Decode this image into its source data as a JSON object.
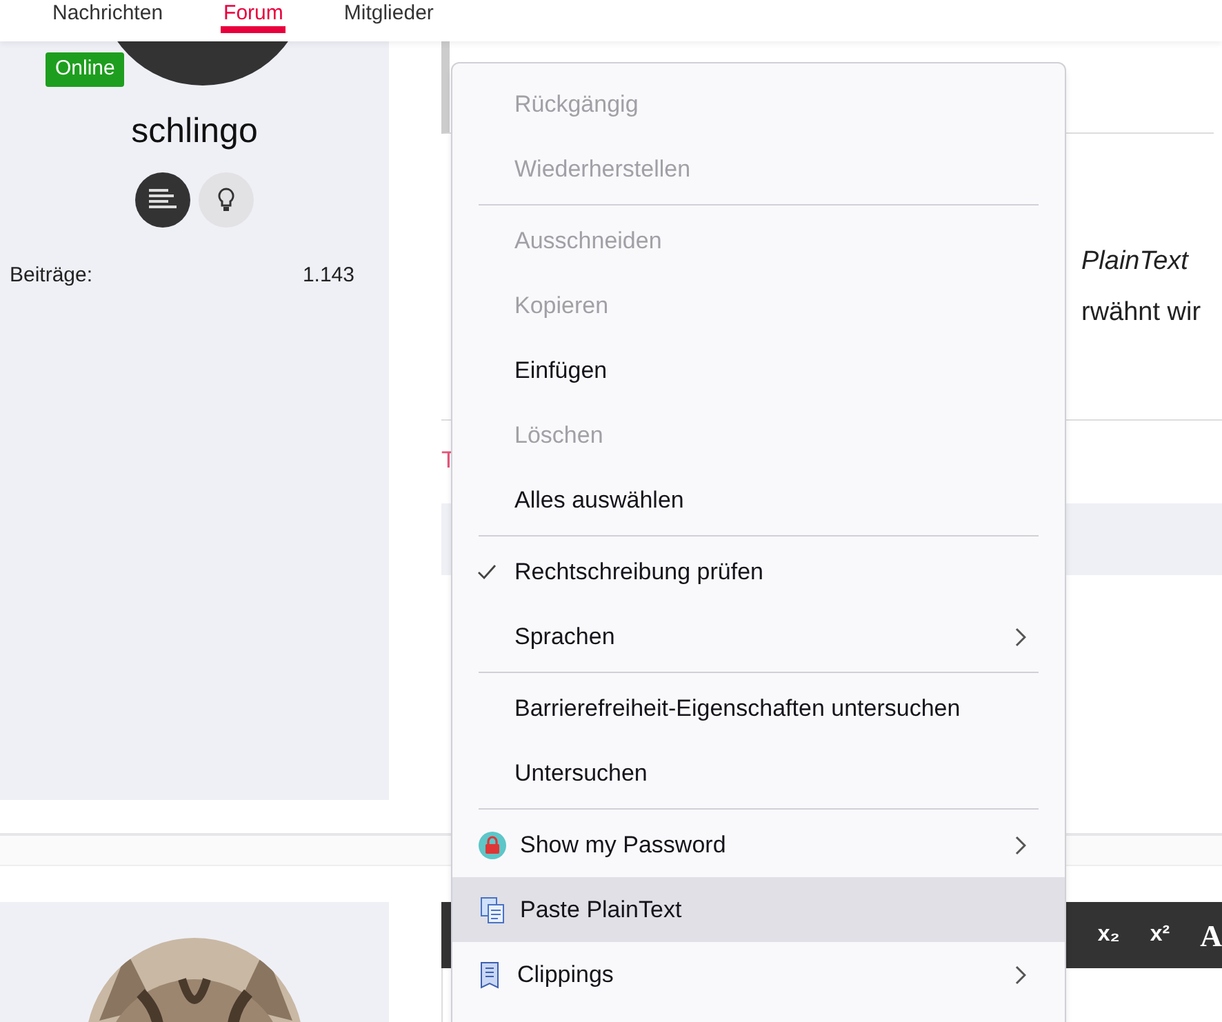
{
  "nav": [
    {
      "label": "Nachrichten",
      "selected": false
    },
    {
      "label": "Forum",
      "selected": true
    },
    {
      "label": "Mitglieder",
      "selected": false
    }
  ],
  "author": {
    "status": "Online",
    "name": "schlingo",
    "stats": [
      {
        "label": "Beiträge:",
        "value": "1.143"
      }
    ]
  },
  "post": {
    "lines": [
      {
        "right": "PlainText",
        "italic": true
      },
      {
        "right": "rwähnt wir",
        "italic": false
      }
    ],
    "links": [
      "T"
    ]
  },
  "context_menu": [
    {
      "kind": "item",
      "label": "Rückgängig",
      "disabled": true,
      "checked": false,
      "submenu": false,
      "selected": false
    },
    {
      "kind": "item",
      "label": "Wiederherstellen",
      "disabled": true,
      "checked": false,
      "submenu": false,
      "selected": false
    },
    {
      "kind": "separator"
    },
    {
      "kind": "item",
      "label": "Ausschneiden",
      "disabled": true,
      "checked": false,
      "submenu": false,
      "selected": false
    },
    {
      "kind": "item",
      "label": "Kopieren",
      "disabled": true,
      "checked": false,
      "submenu": false,
      "selected": false
    },
    {
      "kind": "item",
      "label": "Einfügen",
      "disabled": false,
      "checked": false,
      "submenu": false,
      "selected": false
    },
    {
      "kind": "item",
      "label": "Löschen",
      "disabled": true,
      "checked": false,
      "submenu": false,
      "selected": false
    },
    {
      "kind": "item",
      "label": "Alles auswählen",
      "disabled": false,
      "checked": false,
      "submenu": false,
      "selected": false
    },
    {
      "kind": "separator"
    },
    {
      "kind": "item",
      "label": "Rechtschreibung prüfen",
      "disabled": false,
      "checked": true,
      "submenu": false,
      "selected": false
    },
    {
      "kind": "item",
      "label": "Sprachen",
      "disabled": false,
      "checked": false,
      "submenu": true,
      "selected": false
    },
    {
      "kind": "separator"
    },
    {
      "kind": "item",
      "label": "Barrierefreiheit-Eigenschaften untersuchen",
      "disabled": false,
      "checked": false,
      "submenu": false,
      "selected": false
    },
    {
      "kind": "item",
      "label": "Untersuchen",
      "disabled": false,
      "checked": false,
      "submenu": false,
      "selected": false
    },
    {
      "kind": "separator"
    },
    {
      "kind": "addon",
      "label": "Show my Password",
      "disabled": false,
      "checked": false,
      "submenu": true,
      "selected": false
    },
    {
      "kind": "addon",
      "label": "Paste PlainText",
      "disabled": false,
      "checked": false,
      "submenu": false,
      "selected": true
    },
    {
      "kind": "addon",
      "label": "Clippings",
      "disabled": false,
      "checked": false,
      "submenu": true,
      "selected": false
    }
  ],
  "editor_toolbar": [
    {
      "label": "x₂",
      "kind": "text"
    },
    {
      "label": "x²",
      "kind": "text"
    },
    {
      "label": "A",
      "kind": "serif"
    }
  ]
}
